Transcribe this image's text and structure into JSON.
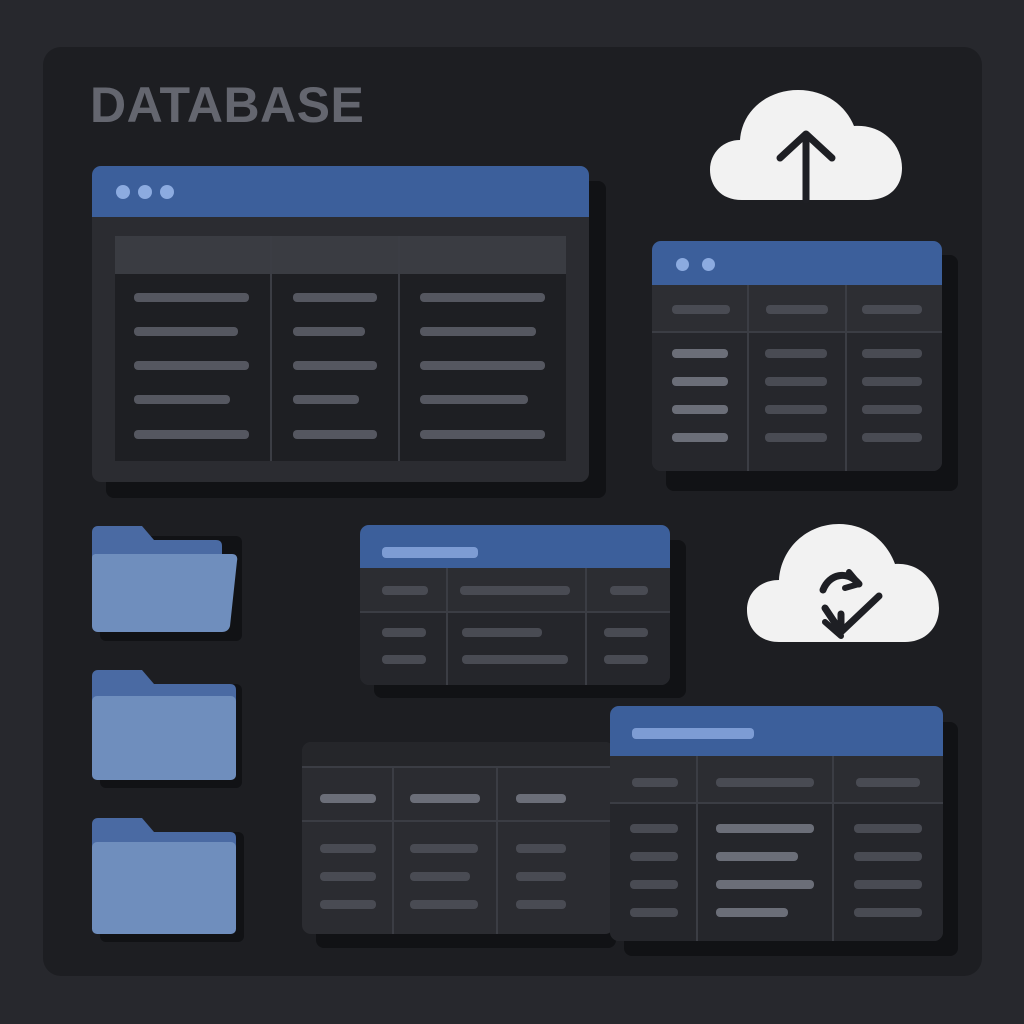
{
  "header": {
    "title": "DATABASE"
  },
  "colors": {
    "background": "#27282d",
    "panel": "#1d1e22",
    "title": "#64666f",
    "accent": "#3c5f9b",
    "folder": "#6f8ebd",
    "folder_tab": "#4a6aa3",
    "cloud": "#f2f2f2",
    "icon_stroke": "#1e1f24"
  },
  "icons": [
    "cloud-upload-icon",
    "cloud-sync-download-icon",
    "folder-icon",
    "folder-icon",
    "folder-icon"
  ]
}
